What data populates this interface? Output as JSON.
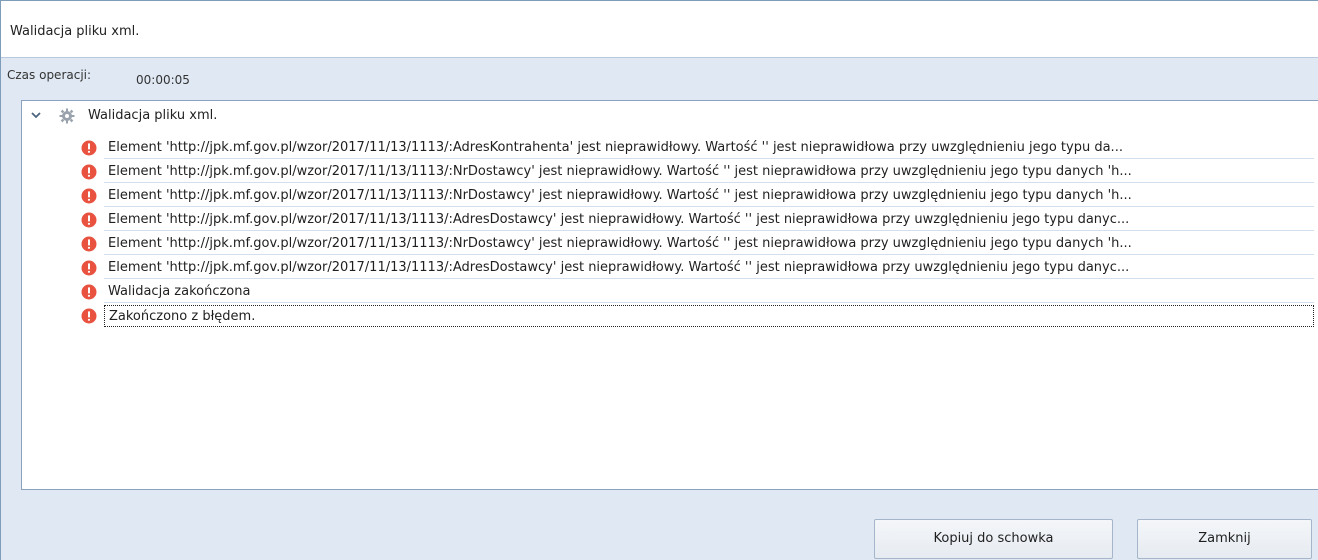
{
  "window": {
    "title": "Walidacja pliku xml."
  },
  "operation": {
    "label": "Czas operacji:",
    "value": "00:00:05"
  },
  "tree": {
    "root": {
      "label": "Walidacja pliku xml.",
      "icon": "gear-icon"
    },
    "items": [
      {
        "icon": "error-icon",
        "text": "Element 'http://jpk.mf.gov.pl/wzor/2017/11/13/1113/:AdresKontrahenta' jest nieprawidłowy. Wartość '' jest nieprawidłowa przy uwzględnieniu jego typu da..."
      },
      {
        "icon": "error-icon",
        "text": "Element 'http://jpk.mf.gov.pl/wzor/2017/11/13/1113/:NrDostawcy' jest nieprawidłowy. Wartość '' jest nieprawidłowa przy uwzględnieniu jego typu danych 'h..."
      },
      {
        "icon": "error-icon",
        "text": "Element 'http://jpk.mf.gov.pl/wzor/2017/11/13/1113/:NrDostawcy' jest nieprawidłowy. Wartość '' jest nieprawidłowa przy uwzględnieniu jego typu danych 'h..."
      },
      {
        "icon": "error-icon",
        "text": "Element 'http://jpk.mf.gov.pl/wzor/2017/11/13/1113/:AdresDostawcy' jest nieprawidłowy. Wartość '' jest nieprawidłowa przy uwzględnieniu jego typu danyc..."
      },
      {
        "icon": "error-icon",
        "text": "Element 'http://jpk.mf.gov.pl/wzor/2017/11/13/1113/:NrDostawcy' jest nieprawidłowy. Wartość '' jest nieprawidłowa przy uwzględnieniu jego typu danych 'h..."
      },
      {
        "icon": "error-icon",
        "text": "Element 'http://jpk.mf.gov.pl/wzor/2017/11/13/1113/:AdresDostawcy' jest nieprawidłowy. Wartość '' jest nieprawidłowa przy uwzględnieniu jego typu danyc..."
      },
      {
        "icon": "error-icon",
        "text": "Walidacja zakończona"
      },
      {
        "icon": "error-icon",
        "text": "Zakończono z błędem."
      }
    ]
  },
  "buttons": {
    "copy": "Kopiuj do schowka",
    "close": "Zamknij"
  },
  "colors": {
    "error": "#e8523f",
    "panel_bg": "#dfe8f3",
    "border": "#8aa2bf"
  }
}
